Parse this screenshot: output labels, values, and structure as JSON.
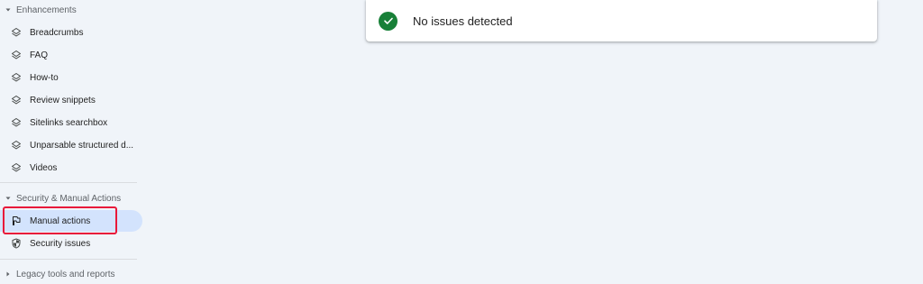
{
  "sidebar": {
    "enhancements": {
      "header": "Enhancements",
      "items": [
        {
          "label": "Breadcrumbs",
          "icon": "layers-icon"
        },
        {
          "label": "FAQ",
          "icon": "layers-icon"
        },
        {
          "label": "How-to",
          "icon": "layers-icon"
        },
        {
          "label": "Review snippets",
          "icon": "layers-icon"
        },
        {
          "label": "Sitelinks searchbox",
          "icon": "layers-icon"
        },
        {
          "label": "Unparsable structured d...",
          "icon": "layers-icon"
        },
        {
          "label": "Videos",
          "icon": "layers-icon"
        }
      ]
    },
    "security": {
      "header": "Security & Manual Actions",
      "items": [
        {
          "label": "Manual actions",
          "icon": "flag-icon",
          "active": true
        },
        {
          "label": "Security issues",
          "icon": "shield-icon"
        }
      ]
    },
    "legacy": {
      "header": "Legacy tools and reports"
    }
  },
  "status_card": {
    "text": "No issues detected",
    "icon": "check-circle-icon"
  },
  "colors": {
    "background": "#f0f4f9",
    "active_item": "#d3e3fd",
    "highlight_border": "#e8183a",
    "success": "#188038"
  }
}
